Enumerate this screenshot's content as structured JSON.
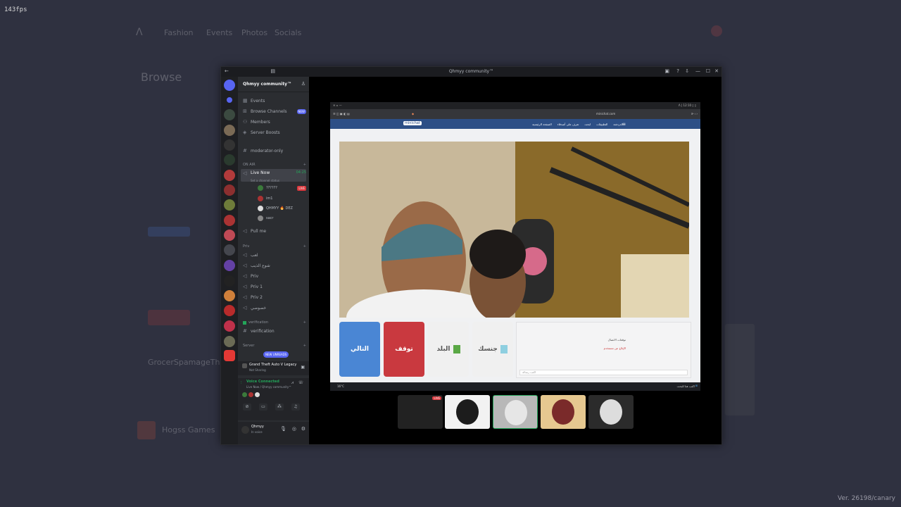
{
  "overlay": {
    "fps": "143fps",
    "version": "Ver. 26198/canary"
  },
  "background_app": {
    "nav": [
      "Fashion",
      "Events",
      "Photos",
      "Socials"
    ],
    "browse_title": "Browse",
    "list_item": "GrocerSpamageTheTuesday",
    "server": "Hogss Games"
  },
  "window": {
    "title": "Qhmyy community™",
    "controls": [
      "—",
      "☐",
      "✕"
    ]
  },
  "sidebar": {
    "server_name": "Qhmyy community™",
    "nav_items": [
      {
        "icon": "calendar-icon",
        "label": "Events"
      },
      {
        "icon": "compass-icon",
        "label": "Browse Channels",
        "badge": "NEW"
      },
      {
        "icon": "members-icon",
        "label": "Members"
      },
      {
        "icon": "boost-icon",
        "label": "Server Boosts"
      }
    ],
    "channels_top": [
      {
        "label": "moderator-only"
      }
    ],
    "category_onair": "ON AIR",
    "live_channel": {
      "label": "Live Now",
      "timer": "04:25",
      "status": "Set a channel status"
    },
    "voice_users": [
      {
        "name": "??????",
        "live": "LIVE"
      },
      {
        "name": "im1"
      },
      {
        "name": "QHMYY 🔥 DEZ"
      },
      {
        "name": "sacr"
      }
    ],
    "pull_channel": "Pull me",
    "category_priv": "Priv",
    "priv_channels": [
      "لعب",
      "شوع الذيب",
      "Priv",
      "Priv 1",
      "Priv 2",
      "خصوصي"
    ],
    "category_verification": "verification",
    "verification_channel": "verification",
    "category_server": "Server",
    "new_unreads": "NEW UNREADS",
    "activity": {
      "title": "Grand Theft Auto V Legacy",
      "subtitle": "Not Sharing"
    },
    "voice_status": {
      "title": "Voice Connected",
      "subtitle": "Live Now / Qhmyy community™"
    },
    "user": {
      "name": "Qhmyy",
      "status": "In voice"
    }
  },
  "stream": {
    "page_nav": [
      "الصفحة الرئيسية",
      "تعرف على أصدقاء",
      "ابحث",
      "التطبيقات",
      "الدردشة"
    ],
    "site_logo": "minichat",
    "address": "minichat.com",
    "buttons": {
      "next": "التالي",
      "stop": "توقف",
      "country": "البلد",
      "gender": "جنسك"
    },
    "chat_status": "توقعات الاتصال",
    "chat_note": "الإبلاغ عن مستخدم",
    "chat_placeholder": "اكتب رسالة",
    "taskbar_search": "اكتب هنا للبحث",
    "taskbar_weather": "16°C",
    "thumb_live": "LIVE"
  },
  "colors": {
    "next_button": "#4a86d4",
    "stop_button": "#c9393f",
    "accent": "#5865f2",
    "live_red": "#da373c",
    "voice_green": "#23a559"
  }
}
